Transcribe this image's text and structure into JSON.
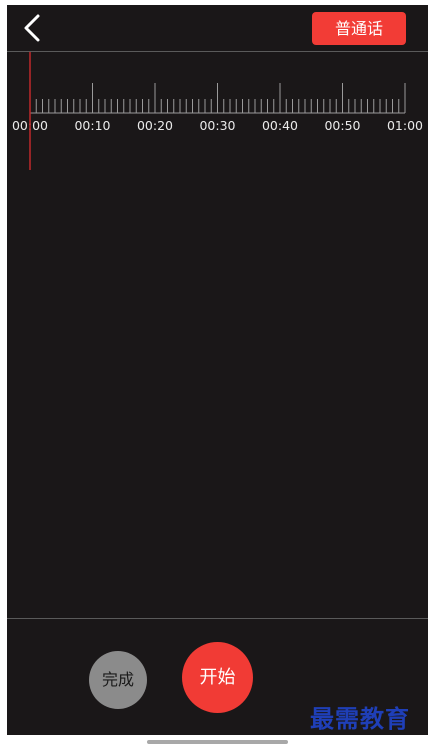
{
  "header": {
    "back_icon": "chevron-left-icon",
    "language_label": "普通话"
  },
  "timeline": {
    "labels": [
      "00:00",
      "00:10",
      "00:20",
      "00:30",
      "00:40",
      "00:50",
      "01:00"
    ],
    "playhead_time": "00:00"
  },
  "controls": {
    "done_label": "完成",
    "start_label": "开始"
  },
  "watermark": "最需教育",
  "colors": {
    "background": "#1a1718",
    "accent": "#f23c36",
    "done_button": "#8b8b8b",
    "playhead": "#c0282a"
  }
}
